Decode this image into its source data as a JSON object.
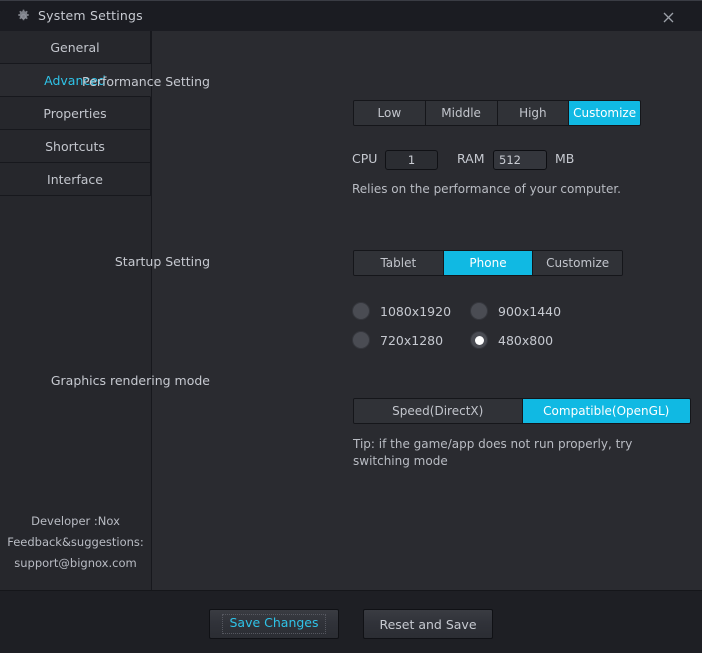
{
  "window": {
    "title": "System Settings",
    "gear_icon": "gear-icon",
    "close_icon": "close-icon"
  },
  "sidebar": {
    "items": [
      {
        "label": "General",
        "active": false
      },
      {
        "label": "Advanced",
        "active": true
      },
      {
        "label": "Properties",
        "active": false
      },
      {
        "label": "Shortcuts",
        "active": false
      },
      {
        "label": "Interface",
        "active": false
      }
    ],
    "footer": {
      "developer": "Developer :Nox",
      "feedback": "Feedback&suggestions:",
      "email": "support@bignox.com"
    }
  },
  "settings": {
    "performance": {
      "label": "Performance Setting",
      "options": [
        "Low",
        "Middle",
        "High",
        "Customize"
      ],
      "selected": "Customize",
      "cpu_label": "CPU",
      "cpu_value": "1",
      "ram_label": "RAM",
      "ram_value": "512",
      "ram_unit": "MB",
      "hint": "Relies on the performance of your computer."
    },
    "startup": {
      "label": "Startup Setting",
      "options": [
        "Tablet",
        "Phone",
        "Customize"
      ],
      "selected": "Phone",
      "resolutions": [
        {
          "label": "1080x1920",
          "selected": false
        },
        {
          "label": "900x1440",
          "selected": false
        },
        {
          "label": "720x1280",
          "selected": false
        },
        {
          "label": "480x800",
          "selected": true
        }
      ]
    },
    "graphics": {
      "label": "Graphics rendering mode",
      "options": [
        "Speed(DirectX)",
        "Compatible(OpenGL)"
      ],
      "selected": "Compatible(OpenGL)",
      "hint_line1": "Tip: if the game/app does not run properly, try",
      "hint_line2": "switching mode"
    }
  },
  "footer": {
    "save_label": "Save Changes",
    "reset_label": "Reset and Save"
  },
  "colors": {
    "accent": "#10b9e3",
    "accent_text": "#2fc3e8",
    "window_bg": "#2a2b30",
    "titlebar_bg": "#1b1c22",
    "sidebar_bg": "#26272c",
    "footer_bg": "#1e1f24"
  }
}
